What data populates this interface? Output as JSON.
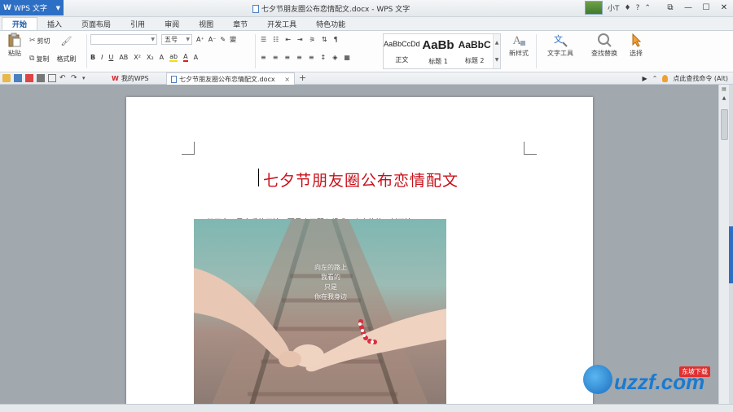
{
  "app": {
    "app_button": "WPS 文字",
    "window_title": "七夕节朋友圈公布恋情配文.docx - WPS 文字",
    "user_name": "小T"
  },
  "tabs": [
    "开始",
    "插入",
    "页面布局",
    "引用",
    "审阅",
    "视图",
    "章节",
    "开发工具",
    "特色功能"
  ],
  "ribbon": {
    "paste": "粘贴",
    "cut": "剪切",
    "copy": "复制",
    "format_painter": "格式刷",
    "font_size": "五号",
    "styles": [
      {
        "preview": "AaBbCcDd",
        "label": "正文"
      },
      {
        "preview": "AaBb",
        "label": "标题 1"
      },
      {
        "preview": "AaBbC",
        "label": "标题 2"
      }
    ],
    "new_style": "新样式",
    "text_tools": "文字工具",
    "find_replace": "查找替换",
    "select": "选择"
  },
  "doctabs": {
    "home": "我的WPS",
    "doc": "七夕节朋友圈公布恋情配文.docx",
    "search_hint": "点此查找命令 (Alt)"
  },
  "document": {
    "title": "七夕节朋友圈公布恋情配文",
    "paragraph": "1、相互交叉是恋爱的开始，而是由两颗心组成一个人的的一刻开始！",
    "photo_text": [
      "向左的路上",
      "我看的",
      "只是",
      "你在我身边"
    ]
  },
  "watermark": {
    "brand": "uzzf.com",
    "badge": "东坡下载"
  },
  "colors": {
    "accent": "#2d6fc4",
    "title_red": "#c8101a"
  }
}
